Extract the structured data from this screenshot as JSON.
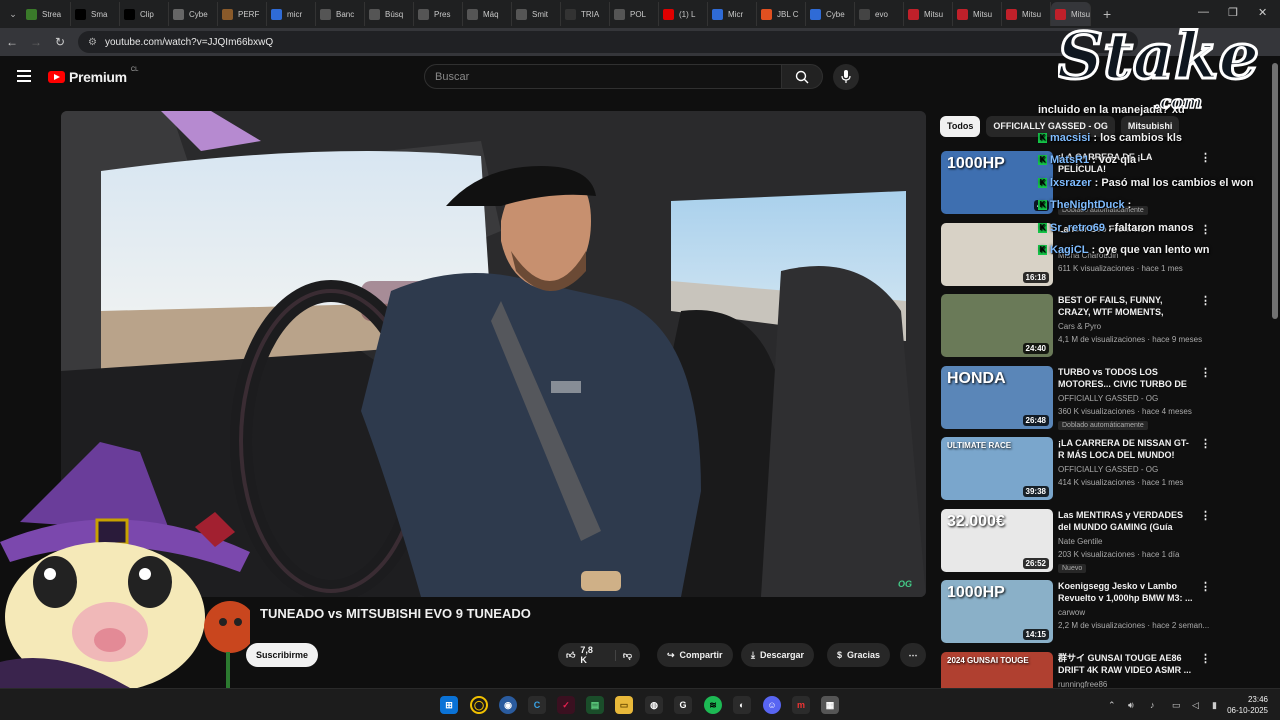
{
  "browser": {
    "tabs": [
      {
        "label": "Strea",
        "icon": "streamer-icon",
        "color": "#3a7a2a"
      },
      {
        "label": "Sma",
        "icon": "vercel-icon",
        "color": "#000000"
      },
      {
        "label": "Clip",
        "icon": "vercel-icon",
        "color": "#000000"
      },
      {
        "label": "Cybe",
        "icon": "globe-icon",
        "color": "#666666"
      },
      {
        "label": "PERF",
        "icon": "perf-icon",
        "color": "#8a5a2a"
      },
      {
        "label": "micr",
        "icon": "jira-icon",
        "color": "#2f6bd6"
      },
      {
        "label": "Banc",
        "icon": "ir-icon",
        "color": "#555555"
      },
      {
        "label": "Búsq",
        "icon": "ir-icon",
        "color": "#555555"
      },
      {
        "label": "Pres",
        "icon": "ir-icon",
        "color": "#555555"
      },
      {
        "label": "Máq",
        "icon": "ir-icon",
        "color": "#555555"
      },
      {
        "label": "Smit",
        "icon": "ir-icon",
        "color": "#555555"
      },
      {
        "label": "TRIA",
        "icon": "triangle-icon",
        "color": "#333333"
      },
      {
        "label": "POL",
        "icon": "globe-icon",
        "color": "#555555"
      },
      {
        "label": "(1) L",
        "icon": "youtube-icon",
        "color": "#e00000"
      },
      {
        "label": "Micr",
        "icon": "jira-icon",
        "color": "#2f6bd6"
      },
      {
        "label": "JBL C",
        "icon": "jbl-icon",
        "color": "#e05020"
      },
      {
        "label": "Cybe",
        "icon": "jira-icon",
        "color": "#2f6bd6"
      },
      {
        "label": "evo",
        "icon": "google-icon",
        "color": "#444444"
      },
      {
        "label": "Mitsu",
        "icon": "mitsubishi-icon",
        "color": "#c0202a"
      },
      {
        "label": "Mitsu",
        "icon": "mitsubishi-icon",
        "color": "#c0202a"
      },
      {
        "label": "Mitsu",
        "icon": "mitsubishi-icon",
        "color": "#c0202a"
      },
      {
        "label": "Mitsu",
        "icon": "mitsubishi-icon",
        "color": "#c0202a"
      }
    ],
    "url": "youtube.com/watch?v=JJQIm66bxwQ"
  },
  "youtube": {
    "logo_text": "Premium",
    "country_code": "CL",
    "search_placeholder": "Buscar"
  },
  "video": {
    "title_visible": "TUNEADO vs MITSUBISHI EVO 9 TUNEADO",
    "channel_fragment": "O · G",
    "subscribe_label": "Suscribirme",
    "likes": "7,8 K",
    "share_label": "Compartir",
    "download_label": "Descargar",
    "thanks_label": "Gracias",
    "watermark": "OG"
  },
  "chips": [
    "Todos",
    "OFFICIALLY GASSED - OG",
    "Mitsubishi"
  ],
  "recommendations": [
    {
      "title": "¡LA CARRERA DE ¡LA PELÍCULA!",
      "channel": "",
      "meta": "",
      "badge": "Doblado automáticamente",
      "duration": "49",
      "thumb": "1000HP"
    },
    {
      "title": "Lancer Evo From Hell",
      "channel": "Misha Charoudin",
      "meta": "611 K visualizaciones · hace 1 mes",
      "badge": "",
      "duration": "16:18",
      "thumb": ""
    },
    {
      "title": "BEST OF FAILS, FUNNY, CRAZY, WTF MOMENTS, CLOSE CALL...",
      "channel": "Cars & Pyro",
      "meta": "4,1 M de visualizaciones · hace 9 meses",
      "badge": "",
      "duration": "24:40",
      "thumb": ""
    },
    {
      "title": "TURBO vs TODOS LOS MOTORES... CIVIC TURBO DE ...",
      "channel": "OFFICIALLY GASSED - OG",
      "meta": "360 K visualizaciones · hace 4 meses",
      "badge": "Doblado automáticamente",
      "duration": "26:48",
      "thumb": "HONDA"
    },
    {
      "title": "¡LA CARRERA DE NISSAN GT-R MÁS LOCA DEL MUNDO!",
      "channel": "OFFICIALLY GASSED - OG",
      "meta": "414 K visualizaciones · hace 1 mes",
      "badge": "",
      "duration": "39:38",
      "thumb": "ULTIMATE RACE"
    },
    {
      "title": "Las MENTIRAS y VERDADES del MUNDO GAMING (Guía Anti-...",
      "channel": "Nate Gentile",
      "meta": "203 K visualizaciones · hace 1 día",
      "badge": "Nuevo",
      "duration": "26:52",
      "thumb": "32.000€"
    },
    {
      "title": "Koenigsegg Jesko v Lambo Revuelto v 1,000hp BMW M3: ...",
      "channel": "carwow",
      "meta": "2,2 M de visualizaciones · hace 2 seman...",
      "badge": "",
      "duration": "14:15",
      "thumb": "1000HP"
    },
    {
      "title": "群サイ GUNSAI TOUGE AE86 DRIFT 4K RAW VIDEO ASMR ...",
      "channel": "runningfree86",
      "meta": "965 K visualizaciones · hace 1 año",
      "badge": "",
      "duration": "",
      "thumb": "2024 GUNSAI TOUGE"
    }
  ],
  "chat": [
    {
      "user": "",
      "text": "incluido en la manejada? xd"
    },
    {
      "user": "macsisi",
      "text": ": los cambios kls"
    },
    {
      "user": "MatsR1",
      "text": ": voz qla"
    },
    {
      "user": "lxsrazer",
      "text": ": Pasó mal los cambios el won"
    },
    {
      "user": "TheNightDuck",
      "text": ":"
    },
    {
      "user": "Sr_retro69",
      "text": ": faltaron manos"
    },
    {
      "user": "KagiCL",
      "text": ": oye que van lento wn"
    }
  ],
  "overlay": {
    "brand": "Stake",
    "brand_sub": ".com"
  },
  "taskbar": {
    "time": "23:46",
    "date": "06-10-2025"
  }
}
